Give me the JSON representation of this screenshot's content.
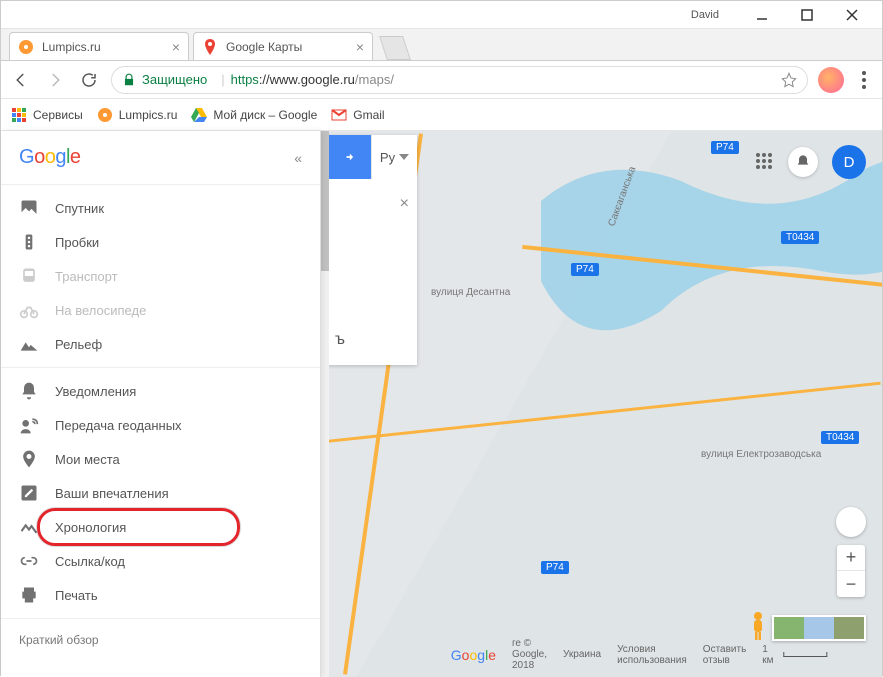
{
  "window": {
    "user": "David"
  },
  "tabs": [
    {
      "title": "Lumpics.ru"
    },
    {
      "title": "Google Карты"
    }
  ],
  "address": {
    "secure_label": "Защищено",
    "protocol": "https",
    "host": "://www.google.ru",
    "path": "/maps/"
  },
  "bookmarks": {
    "services": "Сервисы",
    "lumpics": "Lumpics.ru",
    "drive": "Мой диск – Google ",
    "gmail": "Gmail"
  },
  "sidebar": {
    "group1": {
      "satellite": "Спутник",
      "traffic": "Пробки",
      "transit": "Транспорт",
      "bike": "На велосипеде",
      "terrain": "Рельеф"
    },
    "group2": {
      "notifications": "Уведомления",
      "share_location": "Передача геоданных",
      "my_places": "Мои места",
      "contributions": "Ваши впечатления",
      "timeline": "Хронология",
      "link": "Ссылка/код",
      "print": "Печать"
    },
    "overview": "Краткий обзор"
  },
  "search_panel": {
    "lang": "Ру",
    "letter": "ъ"
  },
  "map_labels": {
    "badges": [
      "P74",
      "T0434",
      "P74",
      "T0434",
      "P74"
    ],
    "streets": [
      "Сакєаганська",
      "вулиця Десантна",
      "вулиця Електрозаводська"
    ]
  },
  "avatar_initial": "D",
  "footer": {
    "copyright": "ге © Google, 2018",
    "country": "Украина",
    "terms": "Условия использования",
    "feedback": "Оставить отзыв",
    "scale": "1 км"
  }
}
